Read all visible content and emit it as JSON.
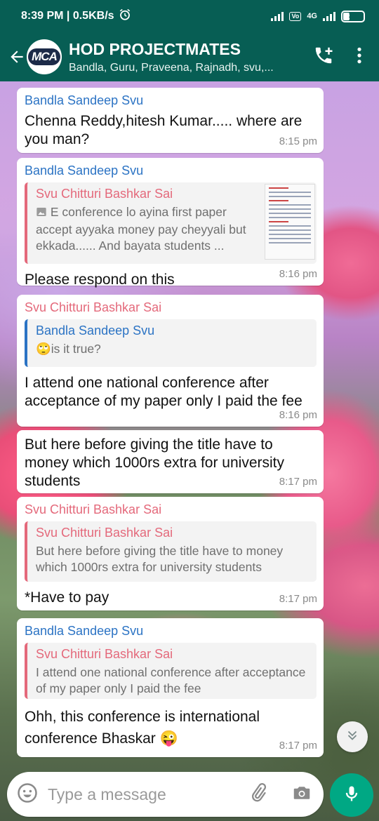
{
  "status": {
    "time_speed": "8:39 PM | 0.5KB/s",
    "volte": "Vo\nLTE",
    "network": "4G",
    "battery": "32"
  },
  "header": {
    "avatar_text": "MCA",
    "title": "HOD PROJECTMATES",
    "subtitle": "Bandla, Guru, Praveena, Rajnadh, svu,..."
  },
  "messages": [
    {
      "sender": "Bandla Sandeep Svu",
      "text": "Chenna Reddy,hitesh Kumar..... where are you man?",
      "time": "8:15 pm"
    },
    {
      "sender": "Bandla Sandeep Svu",
      "quote_sender": "Svu Chitturi Bashkar Sai",
      "quote_text": "E conference lo ayina first paper accept ayyaka money pay cheyyali but ekkada...... And bayata students ...",
      "text": "Please respond on this",
      "time": "8:16 pm"
    },
    {
      "sender": "Svu Chitturi Bashkar Sai",
      "quote_sender": "Bandla Sandeep Svu",
      "quote_text": "🙄is it true?",
      "text": "I attend one national conference after acceptance of my paper only I paid the fee",
      "time": "8:16 pm"
    },
    {
      "text": "But here before giving the title have to money which 1000rs extra for university students",
      "time": "8:17 pm"
    },
    {
      "sender": "Svu Chitturi Bashkar Sai",
      "quote_sender": "Svu Chitturi Bashkar Sai",
      "quote_text": "But here before giving the title have to money which 1000rs extra for university students",
      "text": "*Have to pay",
      "time": "8:17 pm"
    },
    {
      "sender": "Bandla Sandeep Svu",
      "quote_sender": "Svu Chitturi Bashkar Sai",
      "quote_text": "I attend one national conference after acceptance of my paper only I paid the fee",
      "text": "Ohh, this conference is international conference Bhaskar 😜",
      "time": "8:17 pm"
    }
  ],
  "input": {
    "placeholder": "Type a message"
  },
  "colors": {
    "header": "#075e54",
    "sender_blue": "#2b73c4",
    "sender_pink": "#e4697b",
    "mic": "#00a884"
  },
  "icons": [
    "back-arrow-icon",
    "add-call-icon",
    "more-vert-icon",
    "emoji-icon",
    "attach-icon",
    "camera-icon",
    "mic-icon",
    "scroll-down-icon",
    "image-icon",
    "alarm-icon"
  ]
}
